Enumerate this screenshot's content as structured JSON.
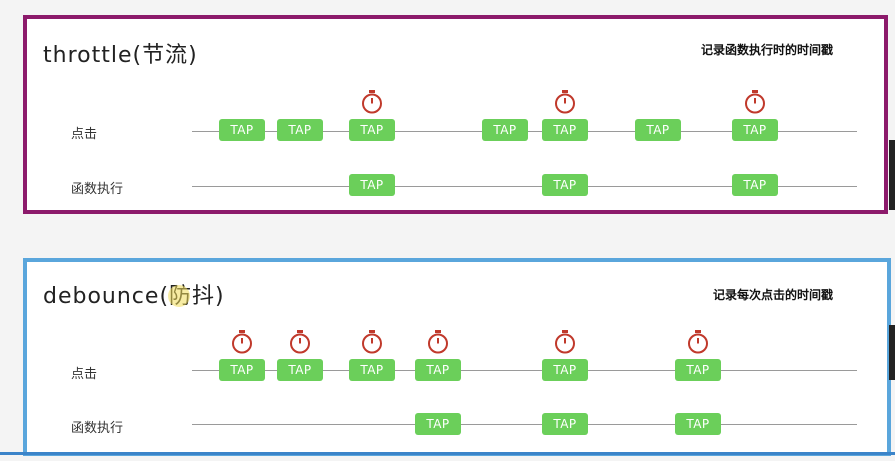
{
  "throttle": {
    "title": "throttle(节流)",
    "note": "记录函数执行时的时间戳",
    "row_click_label": "点击",
    "row_exec_label": "函数执行",
    "tap_label": "TAP",
    "color": "#8c1a6b"
  },
  "debounce": {
    "title": "debounce(防抖)",
    "note": "记录每次点击的时间戳",
    "row_click_label": "点击",
    "row_exec_label": "函数执行",
    "tap_label": "TAP",
    "color": "#5aa6dc"
  },
  "tap_color": "#6bcf5a",
  "timer_color": "#c0392b",
  "icons": [
    "stopwatch-icon"
  ]
}
